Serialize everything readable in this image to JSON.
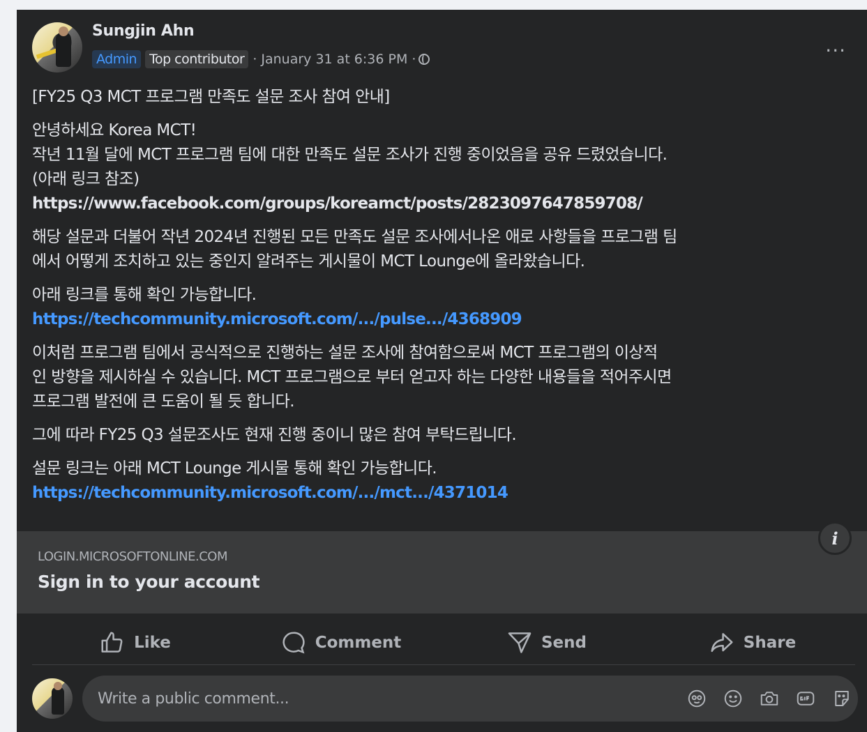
{
  "post": {
    "author": "Sungjin Ahn",
    "badges": {
      "admin": "Admin",
      "top": "Top contributor"
    },
    "timestamp": "· January 31 at 6:36 PM ·",
    "more": "···",
    "paragraphs": [
      [
        "[FY25 Q3 MCT 프로그램 만족도 설문 조사 참여 안내]"
      ],
      [
        "안녕하세요 Korea MCT!",
        "작년 11월 달에 MCT 프로그램 팀에 대한 만족도 설문 조사가 진행 중이었음을 공유 드렸었습니다.",
        "(아래 링크 참조)"
      ],
      [
        "해당 설문과 더불어 작년 2024년 진행된 모든 만족도 설문 조사에서나온 애로 사항들을 프로그램 팀",
        "에서 어떻게 조치하고 있는 중인지 알려주는 게시물이 MCT Lounge에 올라왔습니다."
      ],
      [
        "아래 링크를 통해 확인 가능합니다."
      ],
      [
        "이처럼 프로그램 팀에서 공식적으로 진행하는 설문 조사에 참여함으로써 MCT 프로그램의 이상적",
        "인 방향을 제시하실 수 있습니다. MCT 프로그램으로 부터 얻고자 하는 다양한 내용들을 적어주시면",
        "프로그램 발전에 큰 도움이 될 듯 합니다."
      ],
      [
        "그에 따라 FY25 Q3 설문조사도 현재 진행 중이니 많은 참여 부탁드립니다."
      ],
      [
        "설문 링크는 아래 MCT Lounge 게시물 통해 확인 가능합니다."
      ]
    ],
    "links": {
      "facebook": "https://www.facebook.com/groups/koreamct/posts/2823097647859708/",
      "pulse": "https://techcommunity.microsoft.com/.../pulse.../4368909",
      "mct": "https://techcommunity.microsoft.com/.../mct.../4371014"
    }
  },
  "preview": {
    "domain": "LOGIN.MICROSOFTONLINE.COM",
    "title": "Sign in to your account",
    "info": "i"
  },
  "actions": {
    "like": "Like",
    "comment": "Comment",
    "send": "Send",
    "share": "Share"
  },
  "comment": {
    "placeholder": "Write a public comment..."
  },
  "icons": [
    "globe-icon",
    "more-icon",
    "info-icon",
    "like-icon",
    "comment-icon",
    "send-icon",
    "share-icon",
    "avatar-sticker-icon",
    "emoji-icon",
    "camera-icon",
    "gif-icon",
    "sticker-icon"
  ]
}
